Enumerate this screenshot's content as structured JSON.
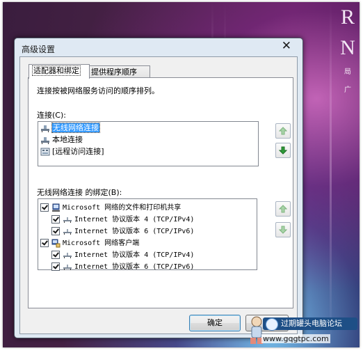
{
  "background": {
    "side_text": [
      "R",
      "N",
      "局",
      "广"
    ]
  },
  "dialog": {
    "title": "高级设置",
    "close_glyph": "✕",
    "tabs": [
      {
        "label": "适配器和绑定",
        "active": true
      },
      {
        "label": "提供程序顺序",
        "active": false
      }
    ],
    "description": "连接按被网络服务访问的顺序排列。",
    "connections_label": "连接(C):",
    "connections": [
      {
        "label": "无线网络连接",
        "icon": "network-adapter-icon",
        "selected": true
      },
      {
        "label": "本地连接",
        "icon": "network-adapter-icon",
        "selected": false
      },
      {
        "label": "[远程访问连接]",
        "icon": "remote-access-icon",
        "selected": false
      }
    ],
    "bindings_label": "无线网络连接 的绑定(B):",
    "bindings": [
      {
        "label": "Microsoft 网络的文件和打印机共享",
        "level": 0,
        "checked": true,
        "icon": "file-print-sharing-icon"
      },
      {
        "label": "Internet 协议版本 4 (TCP/IPv4)",
        "level": 1,
        "checked": true,
        "icon": "protocol-icon"
      },
      {
        "label": "Internet 协议版本 6 (TCP/IPv6)",
        "level": 1,
        "checked": true,
        "icon": "protocol-icon"
      },
      {
        "label": "Microsoft 网络客户端",
        "level": 0,
        "checked": true,
        "icon": "network-client-icon"
      },
      {
        "label": "Internet 协议版本 4 (TCP/IPv4)",
        "level": 1,
        "checked": true,
        "icon": "protocol-icon"
      },
      {
        "label": "Internet 协议版本 6 (TCP/IPv6)",
        "level": 1,
        "checked": true,
        "icon": "protocol-icon"
      }
    ],
    "ok_label": "确定"
  },
  "watermark": {
    "forum_name": "过期罐头电脑论坛",
    "url": "www.gqgtpc.com"
  },
  "colors": {
    "dialog_frame": "#dfe9f3",
    "selection": "#3399ff",
    "arrow_green": "#2e9b38"
  }
}
